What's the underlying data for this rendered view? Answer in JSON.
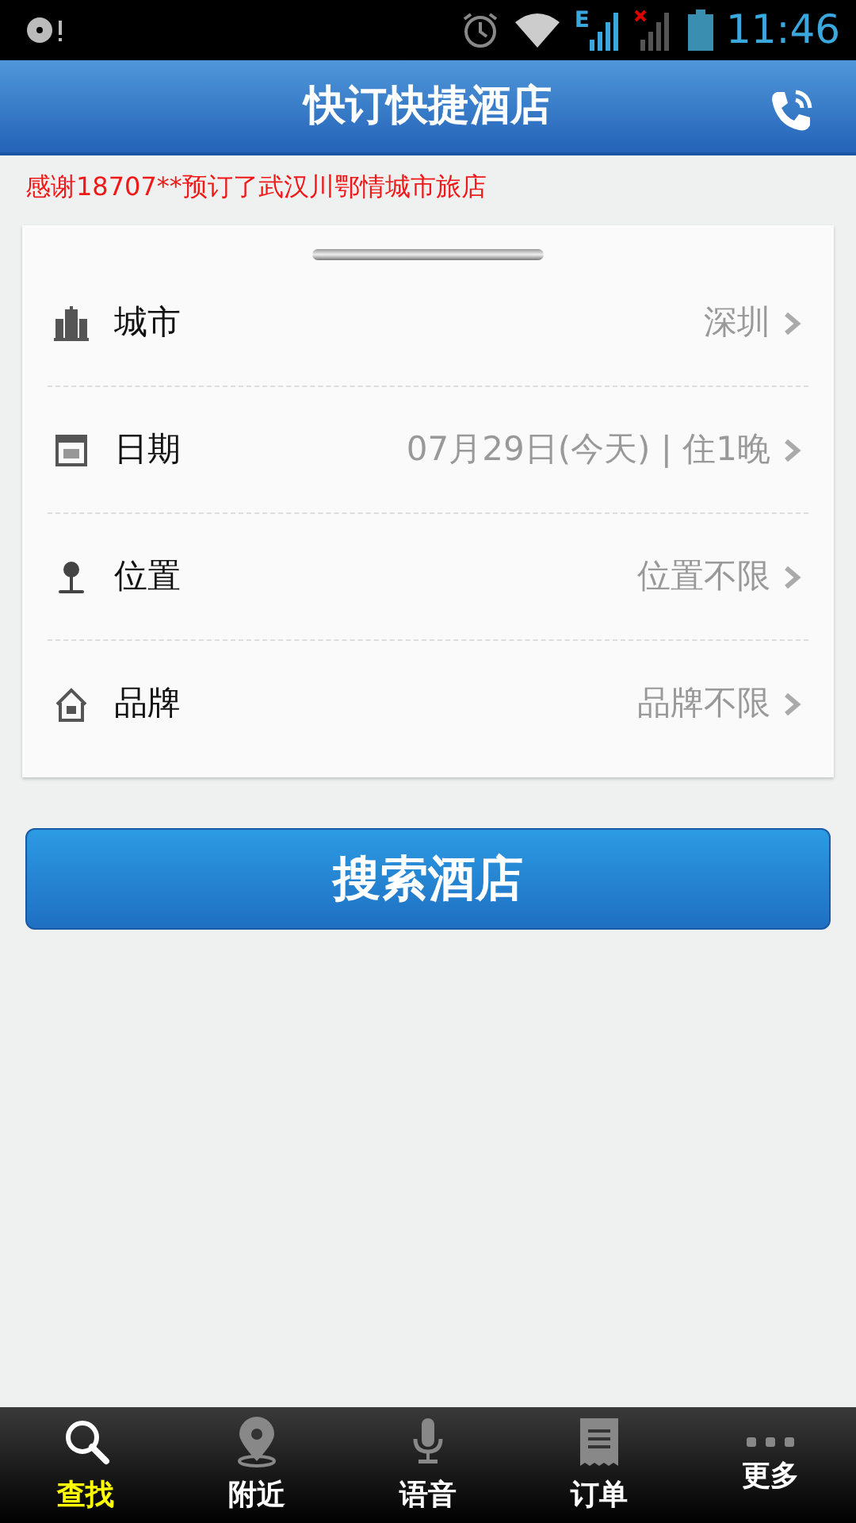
{
  "status_bar": {
    "network": "E",
    "time": "11:46"
  },
  "header": {
    "title": "快订快捷酒店"
  },
  "notice": "感谢18707**预订了武汉川鄂情城市旅店",
  "form_rows": [
    {
      "kind": "city",
      "label": "城市",
      "value": "深圳"
    },
    {
      "kind": "date",
      "label": "日期",
      "value": "07月29日(今天) | 住1晚"
    },
    {
      "kind": "location",
      "label": "位置",
      "value": "位置不限"
    },
    {
      "kind": "brand",
      "label": "品牌",
      "value": "品牌不限"
    }
  ],
  "search_button": "搜索酒店",
  "tabs": [
    {
      "kind": "search",
      "label": "查找",
      "selected": true
    },
    {
      "kind": "nearby",
      "label": "附近",
      "selected": false
    },
    {
      "kind": "voice",
      "label": "语音",
      "selected": false
    },
    {
      "kind": "orders",
      "label": "订单",
      "selected": false
    },
    {
      "kind": "more",
      "label": "更多",
      "selected": false
    }
  ]
}
